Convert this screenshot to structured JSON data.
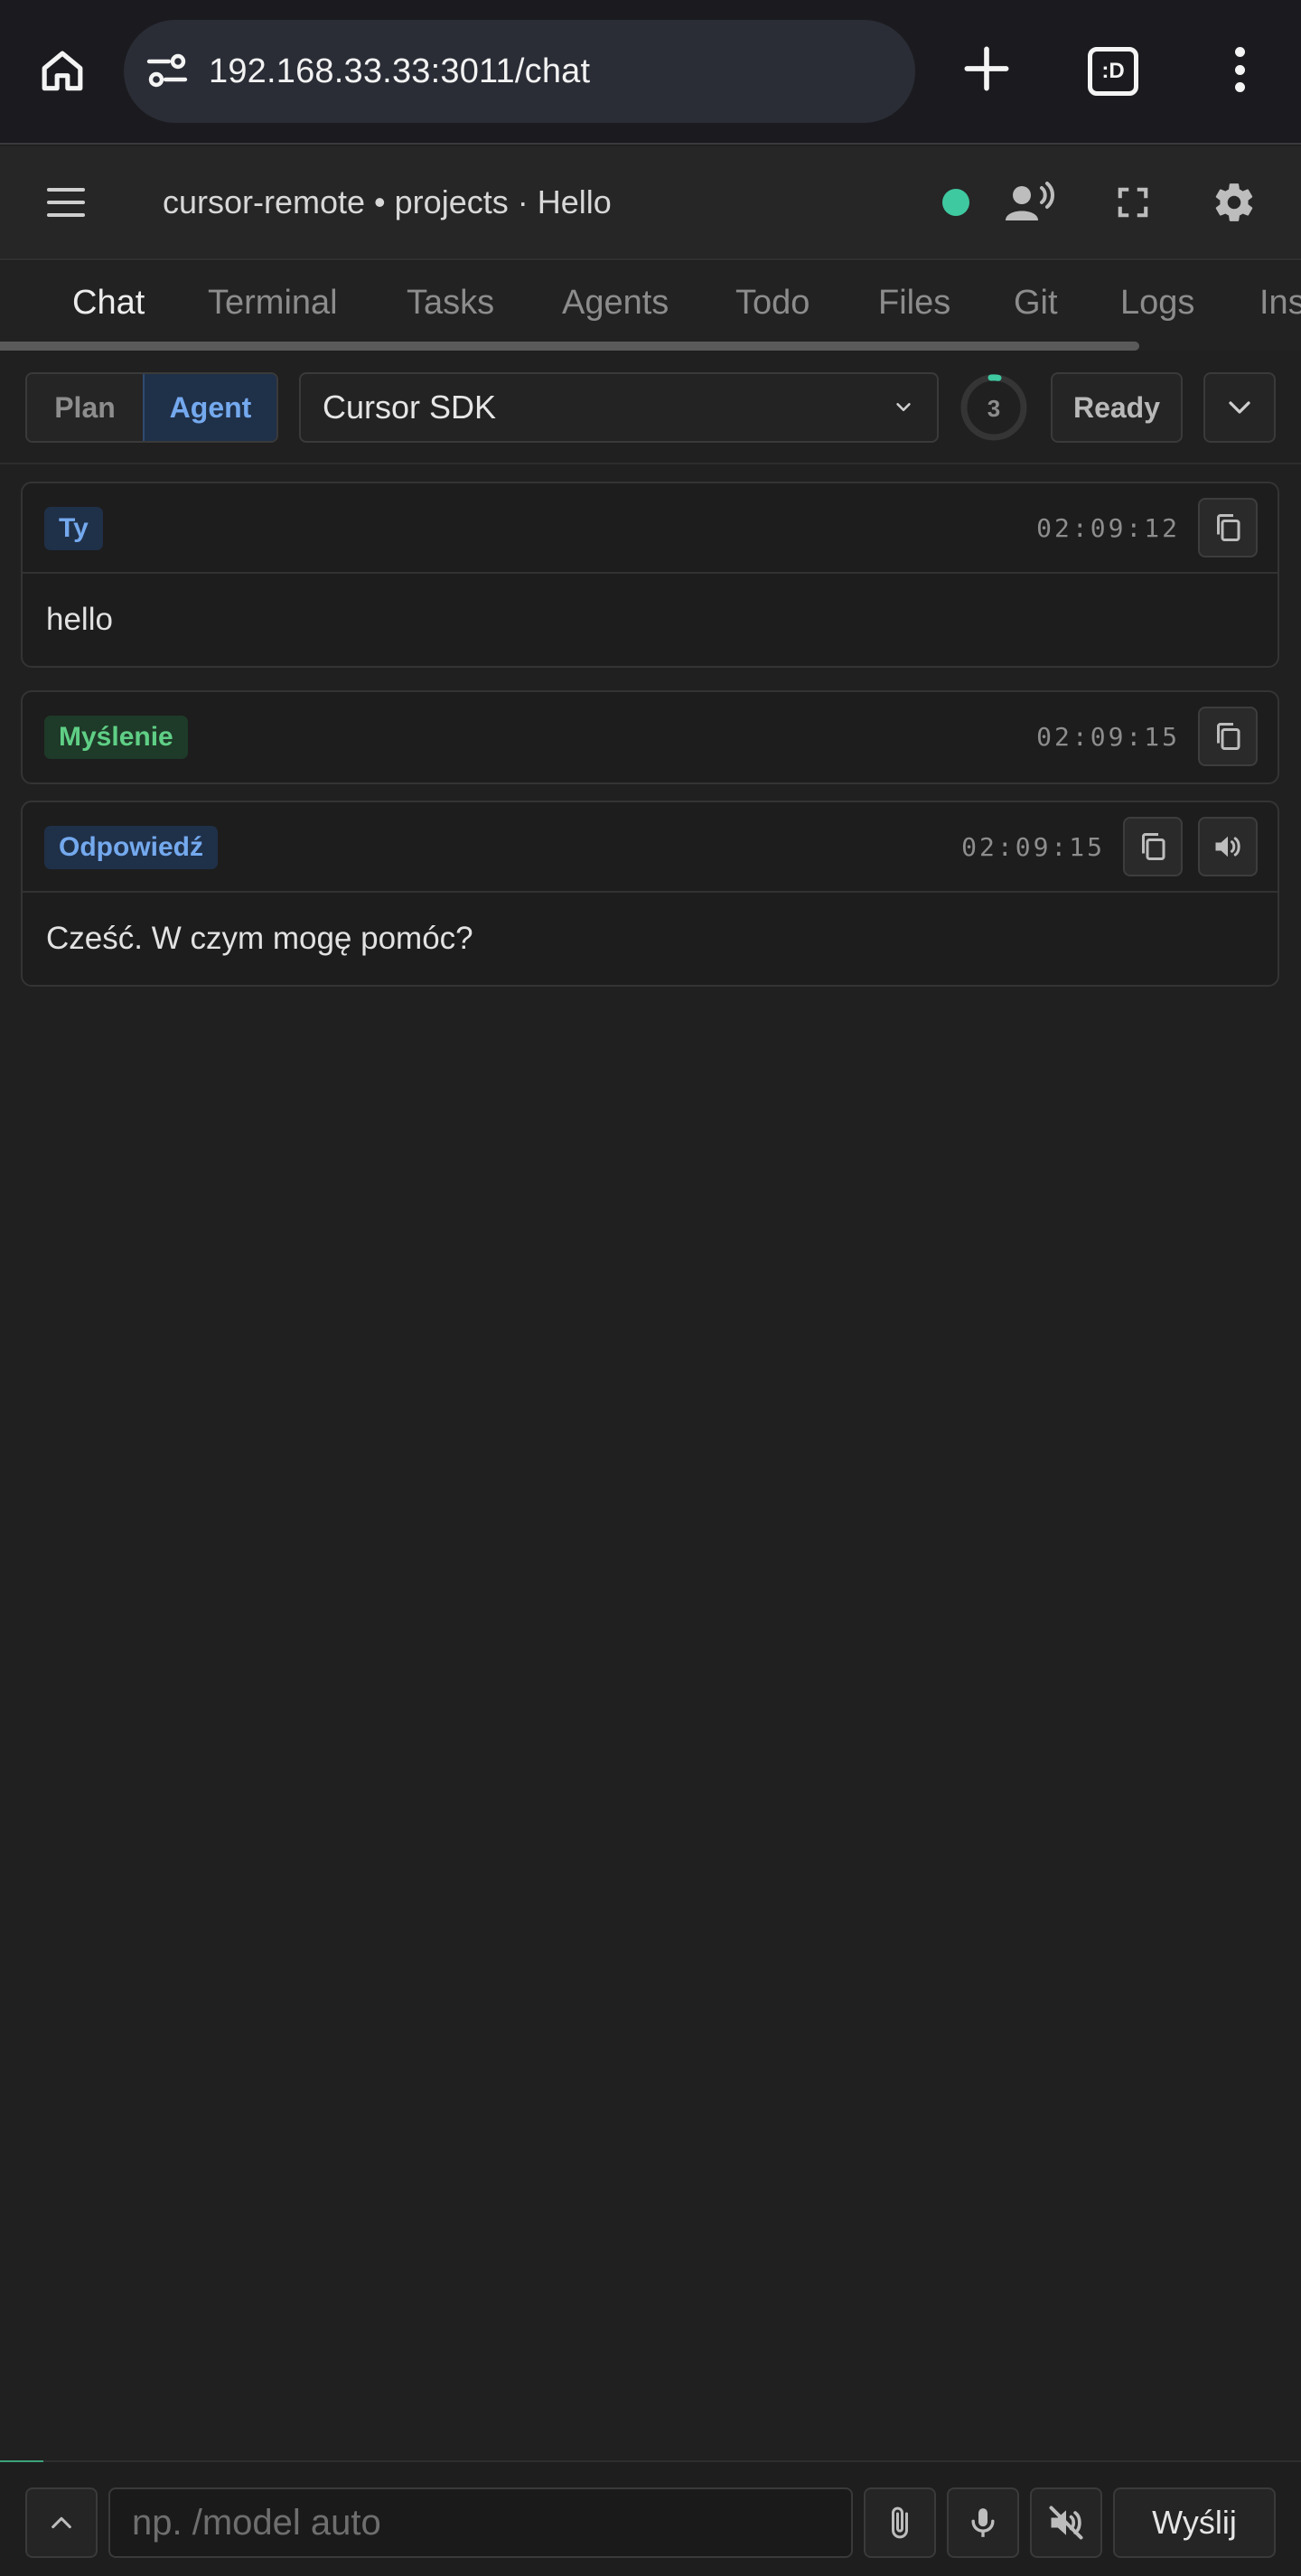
{
  "browser": {
    "url": "192.168.33.33:3011/chat",
    "tabs_badge": ":D"
  },
  "header": {
    "title": "cursor-remote • projects · Hello",
    "status_color": "#3fc9a0"
  },
  "tabs": [
    {
      "label": "Chat",
      "active": true
    },
    {
      "label": "Terminal"
    },
    {
      "label": "Tasks"
    },
    {
      "label": "Agents"
    },
    {
      "label": "Todo"
    },
    {
      "label": "Files"
    },
    {
      "label": "Git"
    },
    {
      "label": "Logs"
    },
    {
      "label": "Ins"
    }
  ],
  "toolbar": {
    "mode_plan": "Plan",
    "mode_agent": "Agent",
    "active_mode": "Agent",
    "model": "Cursor SDK",
    "counter": "3",
    "ready_label": "Ready"
  },
  "messages": [
    {
      "badge": "Ty",
      "time": "02:09:12",
      "text": "hello"
    },
    {
      "badge": "Myślenie",
      "time": "02:09:15"
    },
    {
      "badge": "Odpowiedź",
      "time": "02:09:15",
      "text": "Cześć. W czym mogę pomóc?"
    }
  ],
  "composer": {
    "placeholder": "np. /model auto",
    "send_label": "Wyślij"
  },
  "colors": {
    "accent_blue": "#74a9ee",
    "accent_green": "#5fcf86",
    "background": "#202020"
  }
}
